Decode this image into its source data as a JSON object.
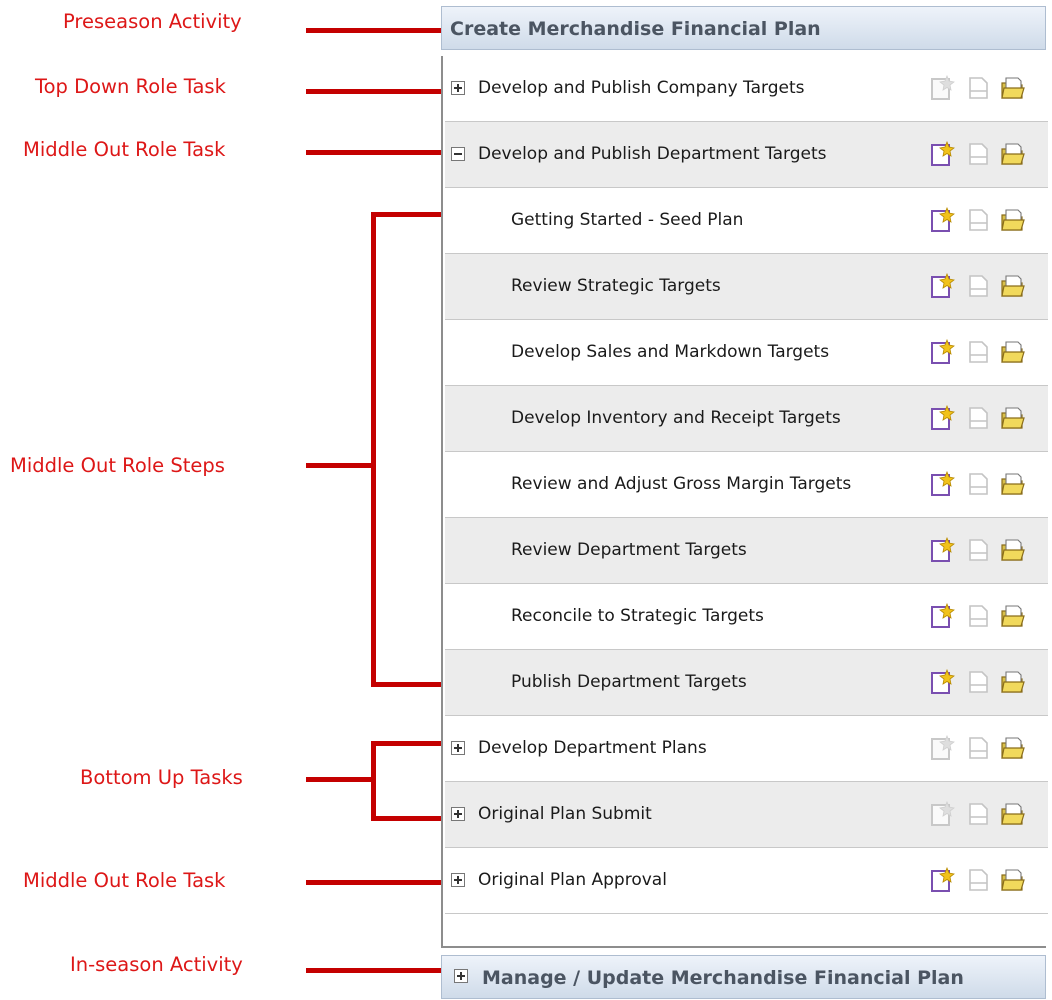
{
  "annotations": {
    "preseason": "Preseason Activity",
    "top_down_task": "Top Down Role Task",
    "middle_out_task": "Middle Out Role Task",
    "middle_out_steps": "Middle Out Role Steps",
    "bottom_up_tasks": "Bottom Up Tasks",
    "middle_out_task_2": "Middle Out Role Task",
    "inseason": "In-season Activity"
  },
  "panel": {
    "header_title": "Create Merchandise Financial Plan",
    "rows": [
      {
        "label": "Develop and Publish Company Targets",
        "kind": "task",
        "toggle": "plus",
        "new_enabled": false
      },
      {
        "label": "Develop and Publish Department Targets",
        "kind": "task",
        "toggle": "minus",
        "new_enabled": true
      },
      {
        "label": "Getting Started - Seed Plan",
        "kind": "step",
        "new_enabled": true
      },
      {
        "label": "Review Strategic Targets",
        "kind": "step",
        "new_enabled": true
      },
      {
        "label": "Develop Sales and Markdown Targets",
        "kind": "step",
        "new_enabled": true
      },
      {
        "label": "Develop Inventory and Receipt Targets",
        "kind": "step",
        "new_enabled": true
      },
      {
        "label": "Review and Adjust Gross Margin Targets",
        "kind": "step",
        "new_enabled": true
      },
      {
        "label": "Review Department Targets",
        "kind": "step",
        "new_enabled": true
      },
      {
        "label": "Reconcile to Strategic Targets",
        "kind": "step",
        "new_enabled": true
      },
      {
        "label": "Publish Department Targets",
        "kind": "step",
        "new_enabled": true
      },
      {
        "label": "Develop Department Plans",
        "kind": "task",
        "toggle": "plus",
        "new_enabled": false
      },
      {
        "label": "Original Plan Submit",
        "kind": "task",
        "toggle": "plus",
        "new_enabled": false
      },
      {
        "label": "Original Plan Approval",
        "kind": "task",
        "toggle": "plus",
        "new_enabled": true
      }
    ],
    "footer_title": "Manage / Update Merchandise Financial Plan"
  },
  "icons": [
    "new-workbook-icon",
    "open-document-icon",
    "open-folder-icon"
  ],
  "colors": {
    "annotation_red": "#dd1717",
    "header_text": "#4b5562",
    "row_shade": "#ececec",
    "folder_yellow": "#f1d95c"
  }
}
